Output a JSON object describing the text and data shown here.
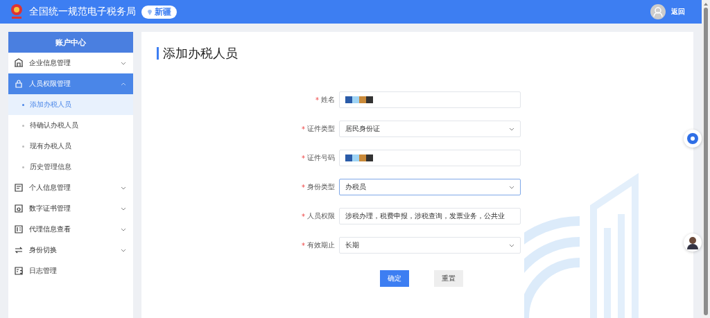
{
  "header": {
    "title": "全国统一规范电子税务局",
    "region": "新疆",
    "back": "返回"
  },
  "sidebar": {
    "title": "账户中心",
    "items": [
      {
        "label": "企业信息管理",
        "expanded": false,
        "selected": false
      },
      {
        "label": "人员权限管理",
        "expanded": true,
        "selected": true,
        "children": [
          {
            "label": "添加办税人员",
            "selected": true
          },
          {
            "label": "待确认办税人员",
            "selected": false
          },
          {
            "label": "现有办税人员",
            "selected": false
          },
          {
            "label": "历史管理信息",
            "selected": false
          }
        ]
      },
      {
        "label": "个人信息管理",
        "expanded": false,
        "selected": false
      },
      {
        "label": "数字证书管理",
        "expanded": false,
        "selected": false
      },
      {
        "label": "代理信息查看",
        "expanded": false,
        "selected": false
      },
      {
        "label": "身份切换",
        "expanded": false,
        "selected": false
      },
      {
        "label": "日志管理",
        "selected": false
      }
    ]
  },
  "page": {
    "title": "添加办税人员"
  },
  "form": {
    "fields": [
      {
        "label": "姓名",
        "required": true,
        "kind": "redacted",
        "focused": false
      },
      {
        "label": "证件类型",
        "required": true,
        "kind": "select",
        "value": "居民身份证",
        "focused": false
      },
      {
        "label": "证件号码",
        "required": true,
        "kind": "redacted",
        "focused": false
      },
      {
        "label": "身份类型",
        "required": true,
        "kind": "select",
        "value": "办税员",
        "focused": true
      },
      {
        "label": "人员权限",
        "required": true,
        "kind": "text",
        "value": "涉税办理，税费申报，涉税查询，发票业务，公共业",
        "focused": false
      },
      {
        "label": "有效期止",
        "required": true,
        "kind": "select",
        "value": "长期",
        "focused": false
      }
    ],
    "required_mark": "*",
    "buttons": [
      {
        "label": "确定",
        "kind": "primary"
      },
      {
        "label": "重置",
        "kind": "secondary"
      }
    ]
  }
}
